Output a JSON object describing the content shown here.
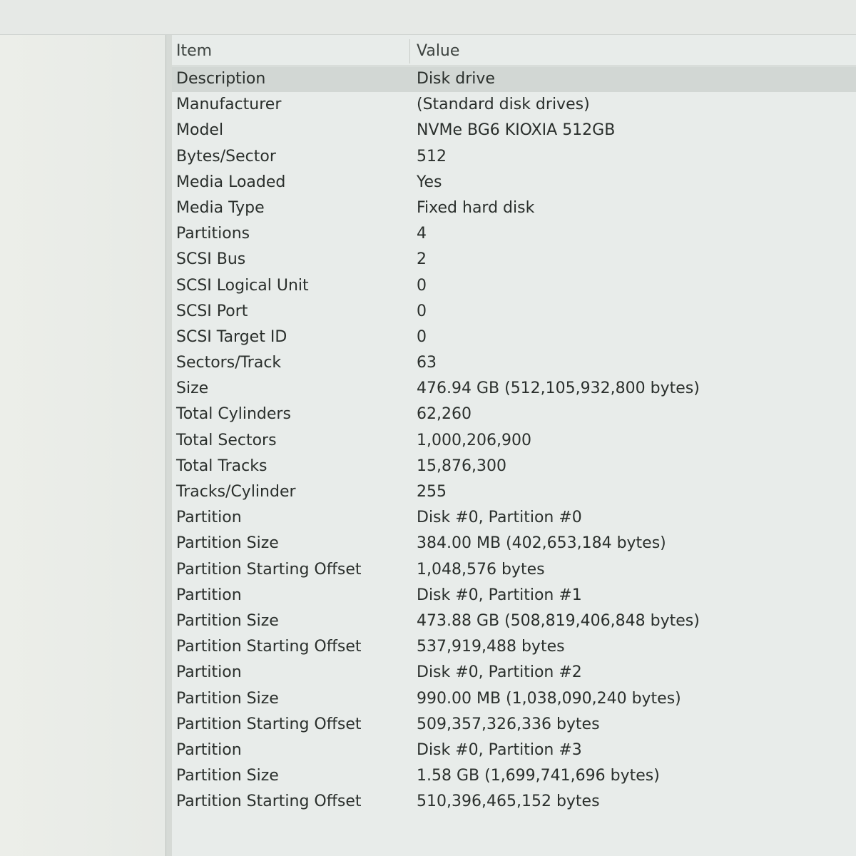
{
  "columns": {
    "item": "Item",
    "value": "Value"
  },
  "rows": [
    {
      "item": "Description",
      "value": "Disk drive",
      "selected": true
    },
    {
      "item": "Manufacturer",
      "value": "(Standard disk drives)"
    },
    {
      "item": "Model",
      "value": "NVMe BG6 KIOXIA 512GB"
    },
    {
      "item": "Bytes/Sector",
      "value": "512"
    },
    {
      "item": "Media Loaded",
      "value": "Yes"
    },
    {
      "item": "Media Type",
      "value": "Fixed hard disk"
    },
    {
      "item": "Partitions",
      "value": "4"
    },
    {
      "item": "SCSI Bus",
      "value": "2"
    },
    {
      "item": "SCSI Logical Unit",
      "value": "0"
    },
    {
      "item": "SCSI Port",
      "value": "0"
    },
    {
      "item": "SCSI Target ID",
      "value": "0"
    },
    {
      "item": "Sectors/Track",
      "value": "63"
    },
    {
      "item": "Size",
      "value": "476.94 GB (512,105,932,800 bytes)"
    },
    {
      "item": "Total Cylinders",
      "value": "62,260"
    },
    {
      "item": "Total Sectors",
      "value": "1,000,206,900"
    },
    {
      "item": "Total Tracks",
      "value": "15,876,300"
    },
    {
      "item": "Tracks/Cylinder",
      "value": "255"
    },
    {
      "item": "Partition",
      "value": "Disk #0, Partition #0"
    },
    {
      "item": "Partition Size",
      "value": "384.00 MB (402,653,184 bytes)"
    },
    {
      "item": "Partition Starting Offset",
      "value": "1,048,576 bytes"
    },
    {
      "item": "Partition",
      "value": "Disk #0, Partition #1"
    },
    {
      "item": "Partition Size",
      "value": "473.88 GB (508,819,406,848 bytes)"
    },
    {
      "item": "Partition Starting Offset",
      "value": "537,919,488 bytes"
    },
    {
      "item": "Partition",
      "value": "Disk #0, Partition #2"
    },
    {
      "item": "Partition Size",
      "value": "990.00 MB (1,038,090,240 bytes)"
    },
    {
      "item": "Partition Starting Offset",
      "value": "509,357,326,336 bytes"
    },
    {
      "item": "Partition",
      "value": "Disk #0, Partition #3"
    },
    {
      "item": "Partition Size",
      "value": "1.58 GB (1,699,741,696 bytes)"
    },
    {
      "item": "Partition Starting Offset",
      "value": "510,396,465,152 bytes"
    }
  ]
}
